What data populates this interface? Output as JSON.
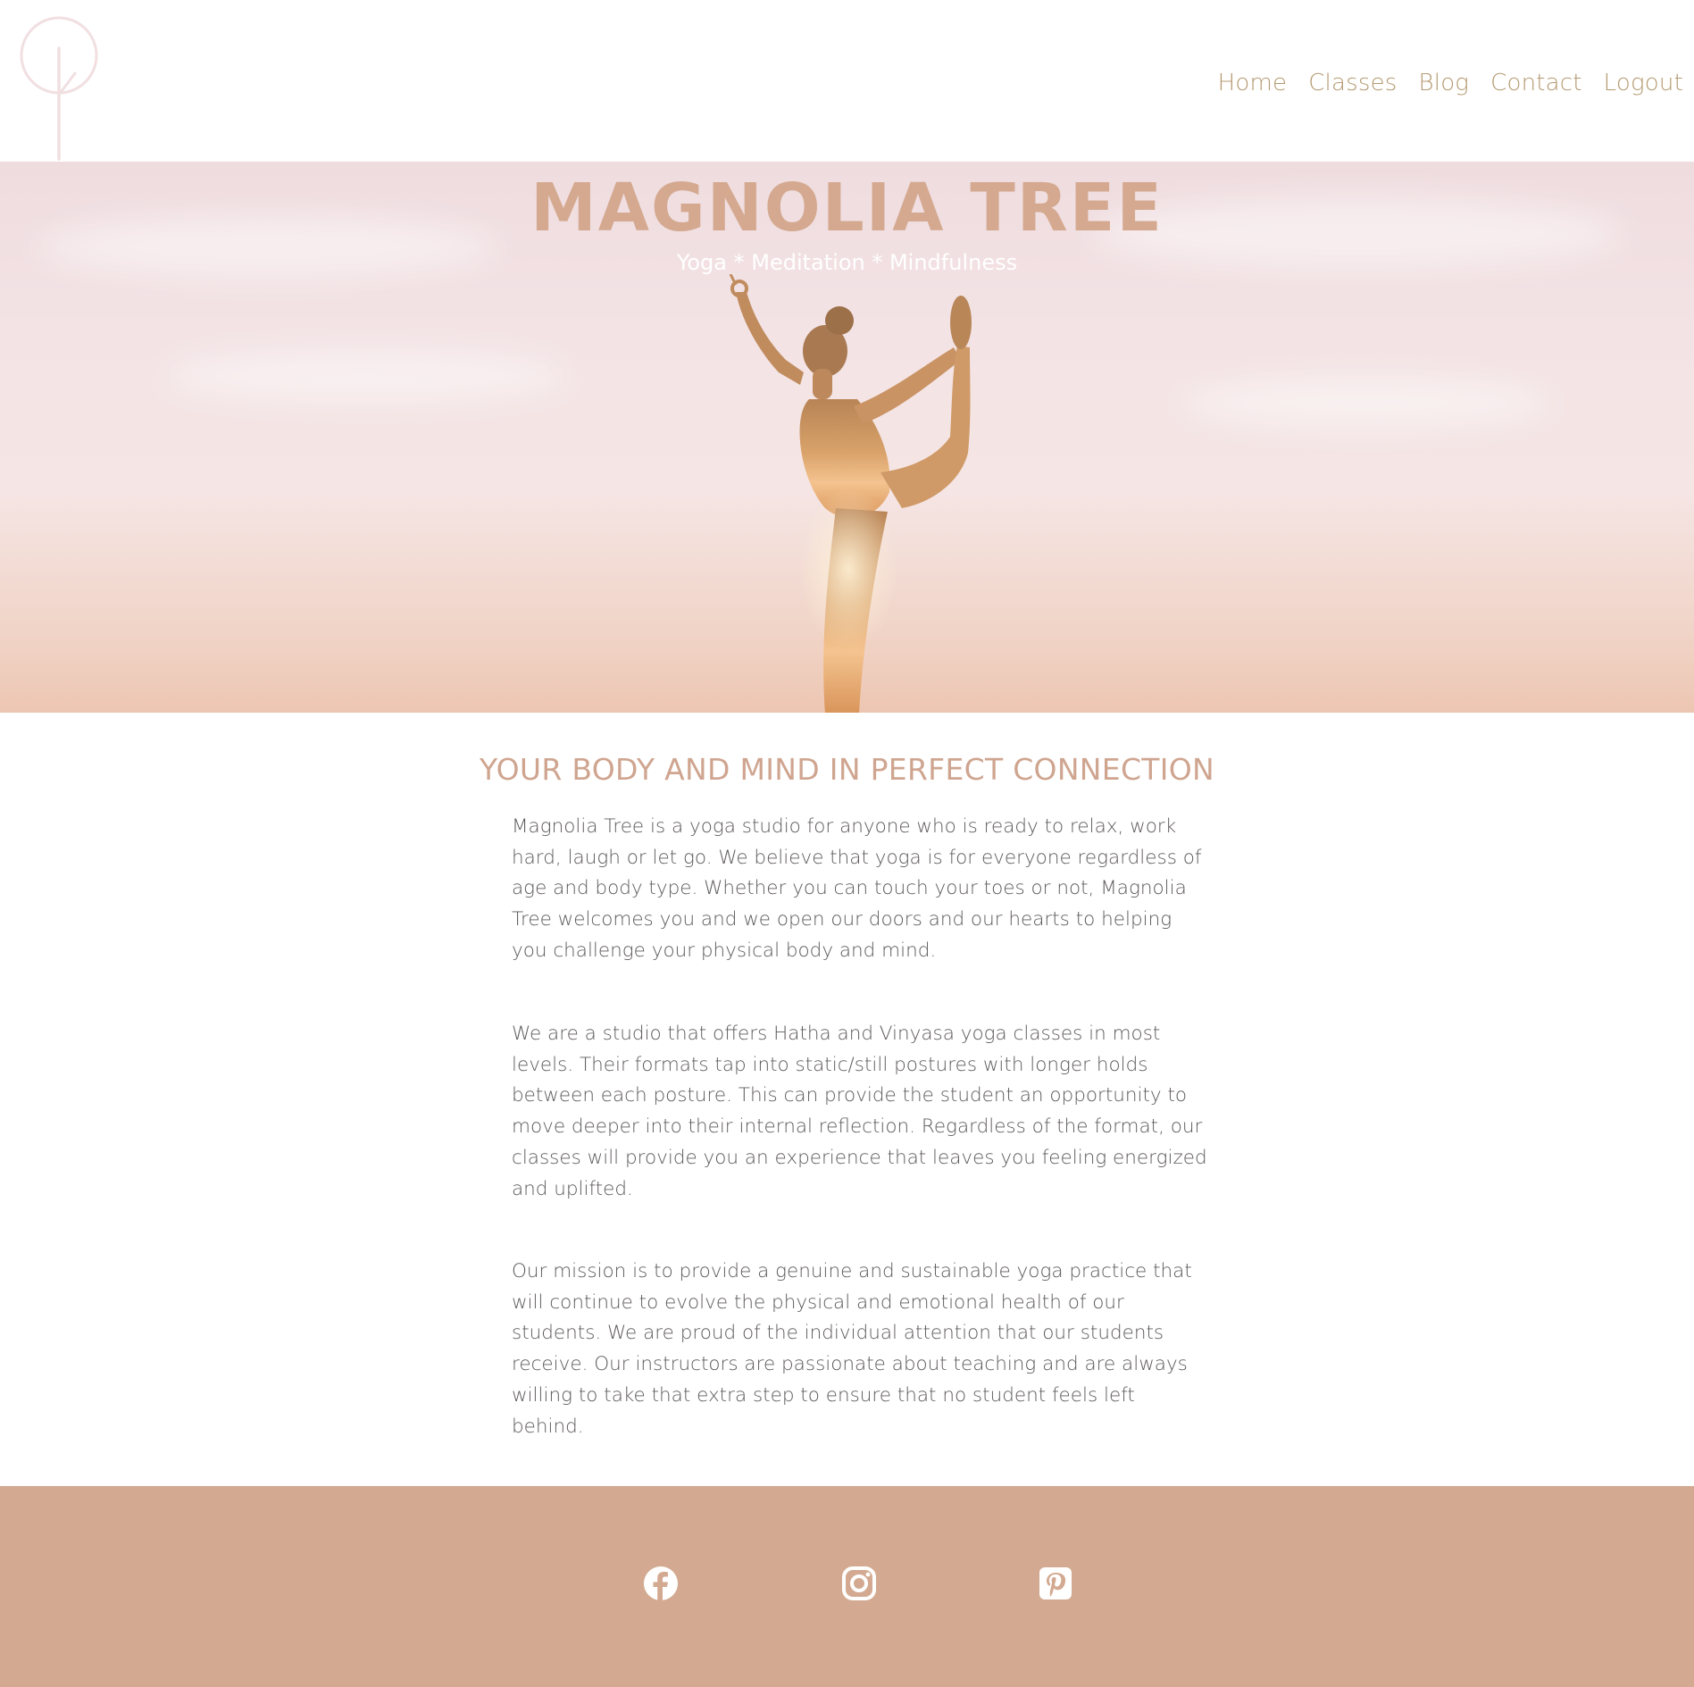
{
  "header": {
    "nav": [
      {
        "label": "Home"
      },
      {
        "label": "Classes"
      },
      {
        "label": "Blog"
      },
      {
        "label": "Contact"
      },
      {
        "label": "Logout"
      }
    ]
  },
  "hero": {
    "title": "MAGNOLIA TREE",
    "subtitle": "Yoga * Meditation * Mindfulness"
  },
  "main": {
    "heading": "YOUR BODY AND MIND IN PERFECT CONNECTION",
    "paragraphs": [
      "Magnolia Tree is a yoga studio for anyone who is ready to relax, work hard, laugh or let go. We believe that yoga is for everyone regardless of age and body type. Whether you can touch your toes or not, Magnolia Tree welcomes you and we open our doors and our hearts to helping you challenge your physical body and mind.",
      "We are a studio that offers Hatha and Vinyasa yoga classes in most levels. Their formats tap into static/still postures with longer holds between each posture. This can provide the student an opportunity to move deeper into their internal reflection. Regardless of the format, our classes will provide you an experience that leaves you feeling energized and uplifted.",
      "Our mission is to provide a genuine and sustainable yoga practice that will continue to evolve the physical and emotional health of our students. We are proud of the individual attention that our students receive. Our instructors are passionate about teaching and are always willing to take that extra step to ensure that no student feels left behind."
    ]
  },
  "footer": {
    "icons": [
      "facebook-icon",
      "instagram-icon",
      "pinterest-icon"
    ]
  },
  "colors": {
    "accent": "#d3aa91",
    "nav_text": "#b59a72",
    "body_text": "#5e5a5a",
    "logo": "#f1dfe1"
  }
}
